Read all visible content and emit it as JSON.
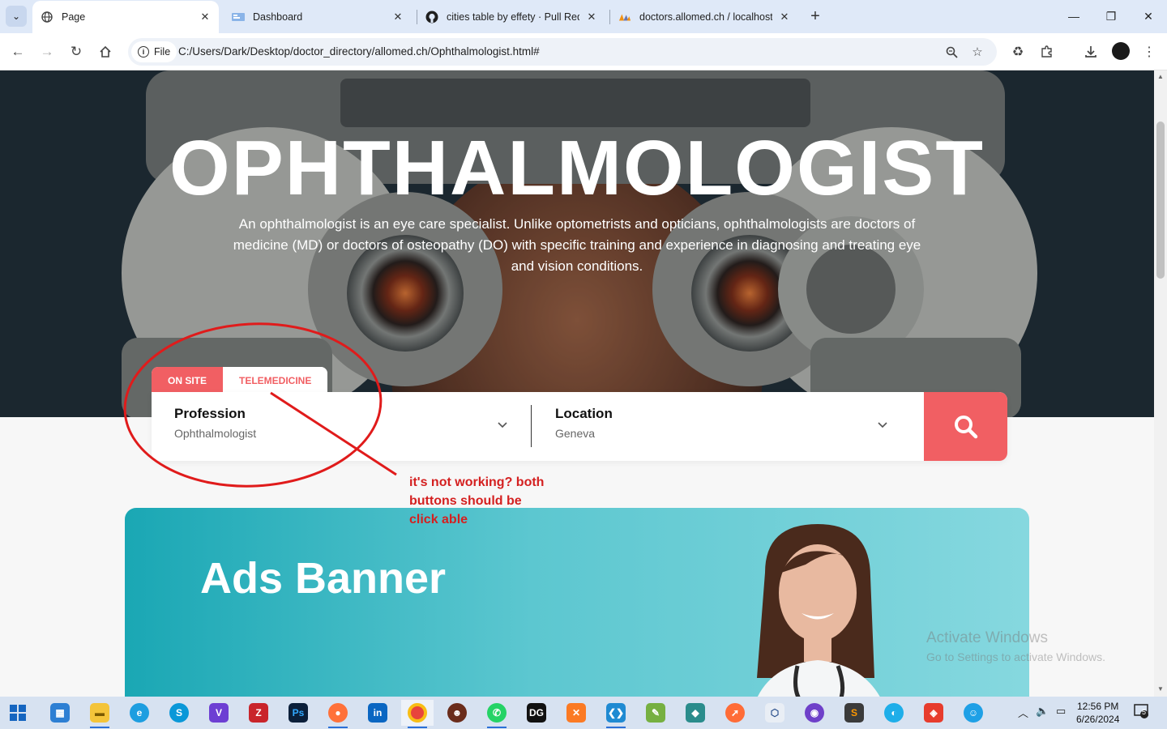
{
  "browser": {
    "tabs": [
      {
        "title": "Page",
        "icon": "globe-icon",
        "active": true
      },
      {
        "title": "Dashboard",
        "icon": "dashboard-favicon-icon",
        "active": false
      },
      {
        "title": "cities table by effety · Pull Requ",
        "icon": "github-icon",
        "active": false
      },
      {
        "title": "doctors.allomed.ch / localhost /",
        "icon": "phpmyadmin-icon",
        "active": false
      }
    ],
    "address_chip": "File",
    "url": "C:/Users/Dark/Desktop/doctor_directory/allomed.ch/Ophthalmologist.html#"
  },
  "hero": {
    "title": "OPHTHALMOLOGIST",
    "description": "An ophthalmologist is an eye care specialist. Unlike optometrists and opticians, ophthalmologists are doctors of medicine (MD) or doctors of osteopathy (DO) with specific training and experience in diagnosing and treating eye and vision conditions."
  },
  "search": {
    "tabs": [
      {
        "label": "ON SITE",
        "selected": true
      },
      {
        "label": "TELEMEDICINE",
        "selected": false
      }
    ],
    "profession": {
      "label": "Profession",
      "value": "Ophthalmologist"
    },
    "location": {
      "label": "Location",
      "value": "Geneva"
    },
    "accent_color": "#f15f63"
  },
  "banner": {
    "title": "Ads Banner"
  },
  "annotation": {
    "text_lines": [
      "it's not working? both",
      "buttons should be",
      "click able"
    ],
    "color": "#d42020"
  },
  "watermark": {
    "line1": "Activate Windows",
    "line2": "Go to Settings to activate Windows."
  },
  "taskbar": {
    "time": "12:56 PM",
    "date": "6/26/2024",
    "notification_count": "5"
  }
}
